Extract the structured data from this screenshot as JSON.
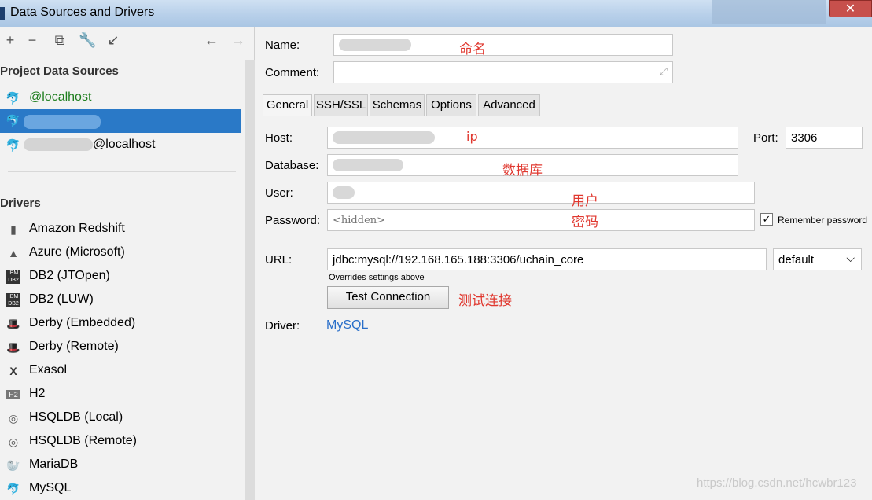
{
  "window": {
    "title": "Data Sources and Drivers",
    "close_label": "✕"
  },
  "toolbar": {
    "add": "+",
    "remove": "−",
    "duplicate": "⧉",
    "settings": "🔧",
    "import": "↙",
    "back": "←",
    "forward": "→"
  },
  "left": {
    "project_header": "Project Data Sources",
    "sources": [
      {
        "label": "@localhost",
        "selected": false
      },
      {
        "label": "",
        "selected": true
      },
      {
        "label": "@localhost",
        "selected": false
      }
    ],
    "drivers_header": "Drivers",
    "drivers": [
      {
        "label": "Amazon Redshift",
        "icon": "redshift-icon"
      },
      {
        "label": "Azure (Microsoft)",
        "icon": "azure-icon"
      },
      {
        "label": "DB2 (JTOpen)",
        "icon": "db2-icon"
      },
      {
        "label": "DB2 (LUW)",
        "icon": "db2-icon"
      },
      {
        "label": "Derby (Embedded)",
        "icon": "derby-icon"
      },
      {
        "label": "Derby (Remote)",
        "icon": "derby-icon"
      },
      {
        "label": "Exasol",
        "icon": "exasol-icon"
      },
      {
        "label": "H2",
        "icon": "h2-icon"
      },
      {
        "label": "HSQLDB (Local)",
        "icon": "hsqldb-icon"
      },
      {
        "label": "HSQLDB (Remote)",
        "icon": "hsqldb-icon"
      },
      {
        "label": "MariaDB",
        "icon": "mariadb-icon"
      },
      {
        "label": "MySQL",
        "icon": "mysql-icon"
      }
    ]
  },
  "form": {
    "name_label": "Name:",
    "name_note": "命名",
    "comment_label": "Comment:",
    "tabs": [
      "General",
      "SSH/SSL",
      "Schemas",
      "Options",
      "Advanced"
    ],
    "host_label": "Host:",
    "host_note": "ip",
    "port_label": "Port:",
    "port_value": "3306",
    "database_label": "Database:",
    "database_note": "数据库",
    "user_label": "User:",
    "user_note": "用户",
    "password_label": "Password:",
    "password_placeholder": "<hidden>",
    "password_note": "密码",
    "remember_label": "Remember password",
    "remember_checked": "✓",
    "url_label": "URL:",
    "url_value": "jdbc:mysql://192.168.165.188:3306/uchain_core",
    "url_mode": "default",
    "url_hint": "Overrides settings above",
    "test_button": "Test Connection",
    "test_note": "测试连接",
    "driver_label": "Driver:",
    "driver_value": "MySQL"
  },
  "watermark": "https://blog.csdn.net/hcwbr123"
}
